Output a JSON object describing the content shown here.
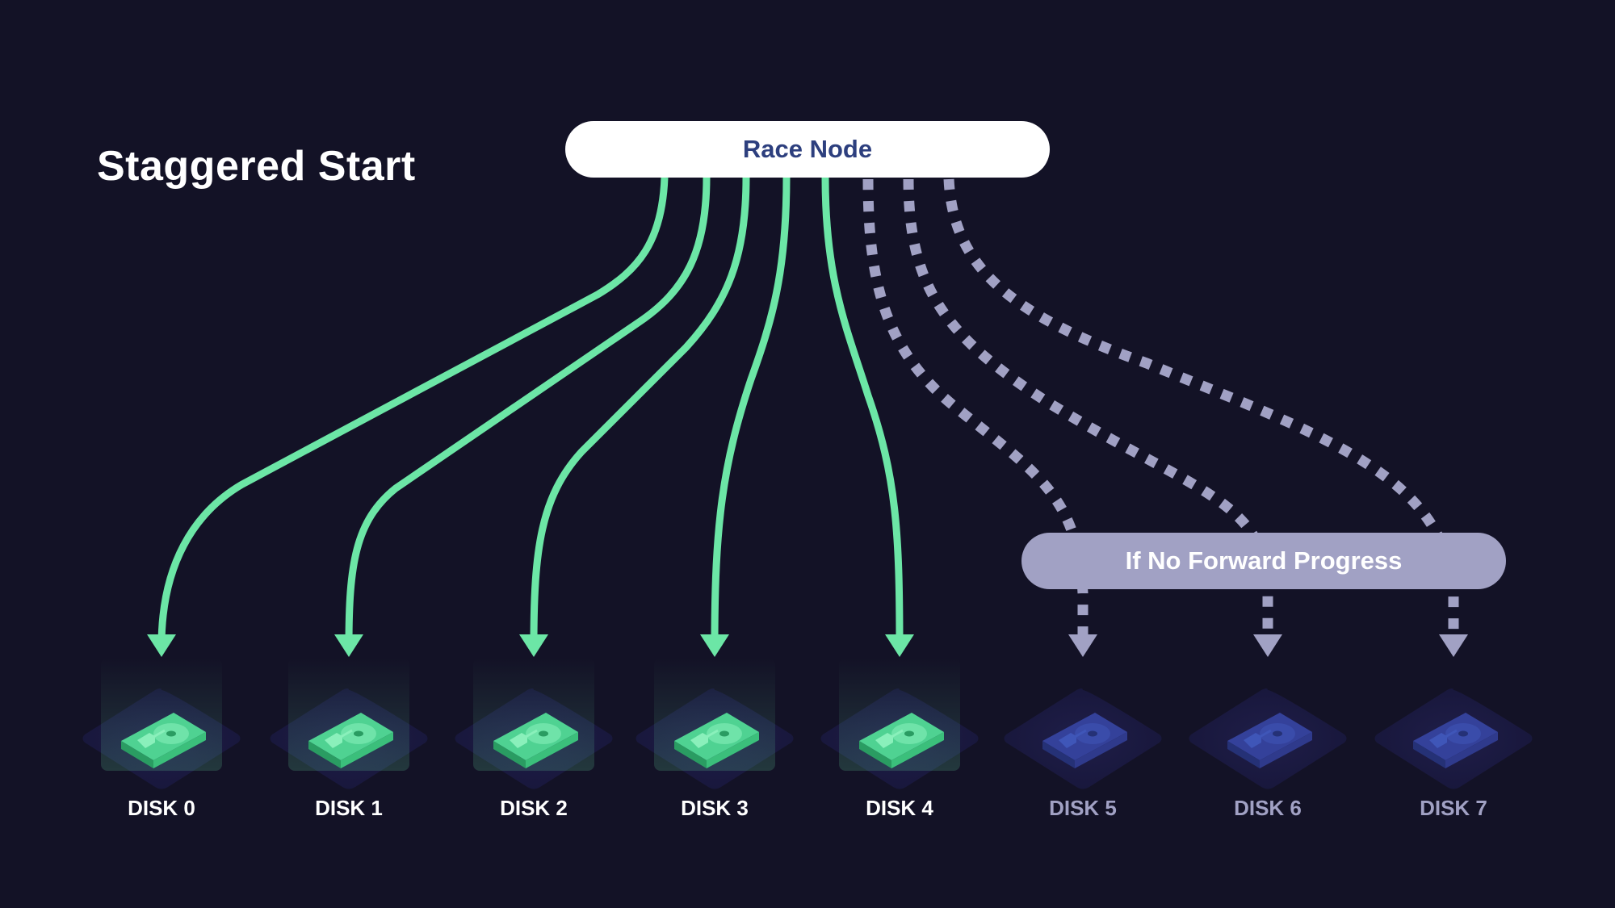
{
  "title": "Staggered Start",
  "race_node": {
    "label": "Race Node"
  },
  "fallback_node": {
    "label": "If No Forward Progress"
  },
  "colors": {
    "background": "#131226",
    "active": "#6ce6a6",
    "inactive": "#a1a1c4",
    "race_node_text": "#2d3f7e",
    "disk_active_body": "#3bbf7b",
    "disk_inactive_body": "#2f3a8c"
  },
  "disks": [
    {
      "label": "DISK 0",
      "state": "active",
      "connection": "solid"
    },
    {
      "label": "DISK 1",
      "state": "active",
      "connection": "solid"
    },
    {
      "label": "DISK 2",
      "state": "active",
      "connection": "solid"
    },
    {
      "label": "DISK 3",
      "state": "active",
      "connection": "solid"
    },
    {
      "label": "DISK 4",
      "state": "active",
      "connection": "solid"
    },
    {
      "label": "DISK 5",
      "state": "inactive",
      "connection": "dashed"
    },
    {
      "label": "DISK 6",
      "state": "inactive",
      "connection": "dashed"
    },
    {
      "label": "DISK 7",
      "state": "inactive",
      "connection": "dashed"
    }
  ]
}
